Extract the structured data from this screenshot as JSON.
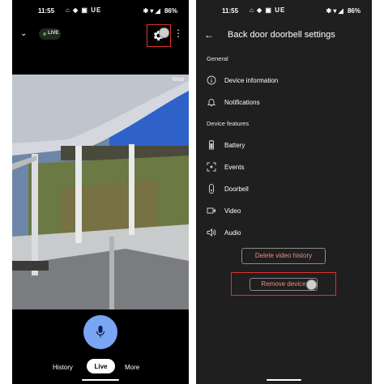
{
  "status_bar": {
    "time": "11:55",
    "carrier": "UE",
    "battery": "86%"
  },
  "live_view": {
    "live_badge": "LIVE",
    "watermark": "Nest",
    "nav": {
      "history": "History",
      "live": "Live",
      "more": "More"
    }
  },
  "settings": {
    "title": "Back door doorbell settings",
    "general_header": "General",
    "general_items": [
      {
        "label": "Device information",
        "icon": "info-icon"
      },
      {
        "label": "Notifications",
        "icon": "bell-icon"
      }
    ],
    "features_header": "Device features",
    "feature_items": [
      {
        "label": "Battery",
        "icon": "battery-icon"
      },
      {
        "label": "Events",
        "icon": "events-icon"
      },
      {
        "label": "Doorbell",
        "icon": "doorbell-icon"
      },
      {
        "label": "Video",
        "icon": "video-icon"
      },
      {
        "label": "Audio",
        "icon": "speaker-icon"
      }
    ],
    "delete_history_label": "Delete video history",
    "remove_device_label": "Remove device"
  },
  "colors": {
    "highlight": "#e03030",
    "live_green": "#34a853",
    "mic_blue": "#7aa4f4",
    "danger_text": "#f08c84"
  }
}
